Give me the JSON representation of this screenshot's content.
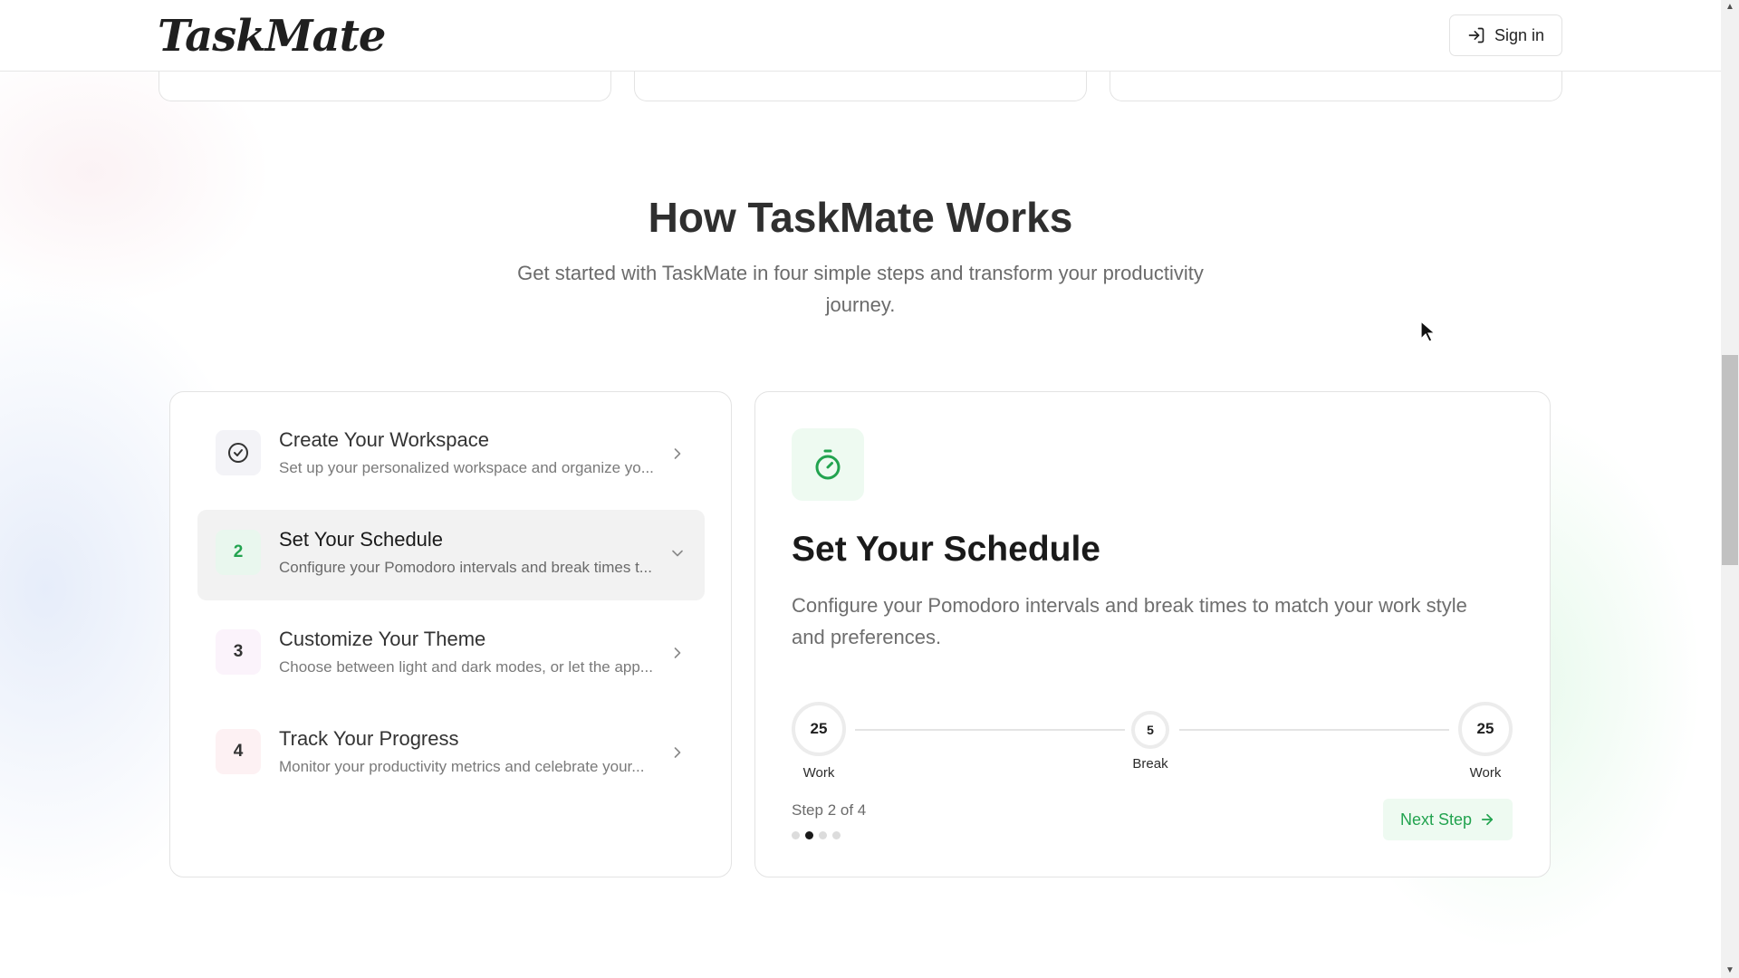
{
  "header": {
    "logo": "TaskMate",
    "signin_label": "Sign in"
  },
  "section": {
    "title": "How TaskMate Works",
    "subtitle": "Get started with TaskMate in four simple steps and transform your productivity journey."
  },
  "steps": [
    {
      "badge": "",
      "icon": "check-circle-icon",
      "title": "Create Your Workspace",
      "desc": "Set up your personalized workspace and organize yo...",
      "state": "collapsed"
    },
    {
      "badge": "2",
      "title": "Set Your Schedule",
      "desc": "Configure your Pomodoro intervals and break times t...",
      "state": "active"
    },
    {
      "badge": "3",
      "title": "Customize Your Theme",
      "desc": "Choose between light and dark modes, or let the app...",
      "state": "collapsed"
    },
    {
      "badge": "4",
      "title": "Track Your Progress",
      "desc": "Monitor your productivity metrics and celebrate your...",
      "state": "collapsed"
    }
  ],
  "detail": {
    "icon": "stopwatch-icon",
    "title": "Set Your Schedule",
    "description": "Configure your Pomodoro intervals and break times to match your work style and preferences.",
    "timeline": [
      {
        "value": "25",
        "label": "Work"
      },
      {
        "value": "5",
        "label": "Break"
      },
      {
        "value": "25",
        "label": "Work"
      }
    ],
    "step_counter": "Step 2 of 4",
    "current_step": 2,
    "total_steps": 4,
    "next_label": "Next Step"
  },
  "colors": {
    "accent_green": "#22a34f",
    "accent_green_bg": "#eefaf1",
    "badge_2_color": "#22a34f",
    "badge_3_color": "#333333",
    "badge_4_color": "#333333"
  }
}
